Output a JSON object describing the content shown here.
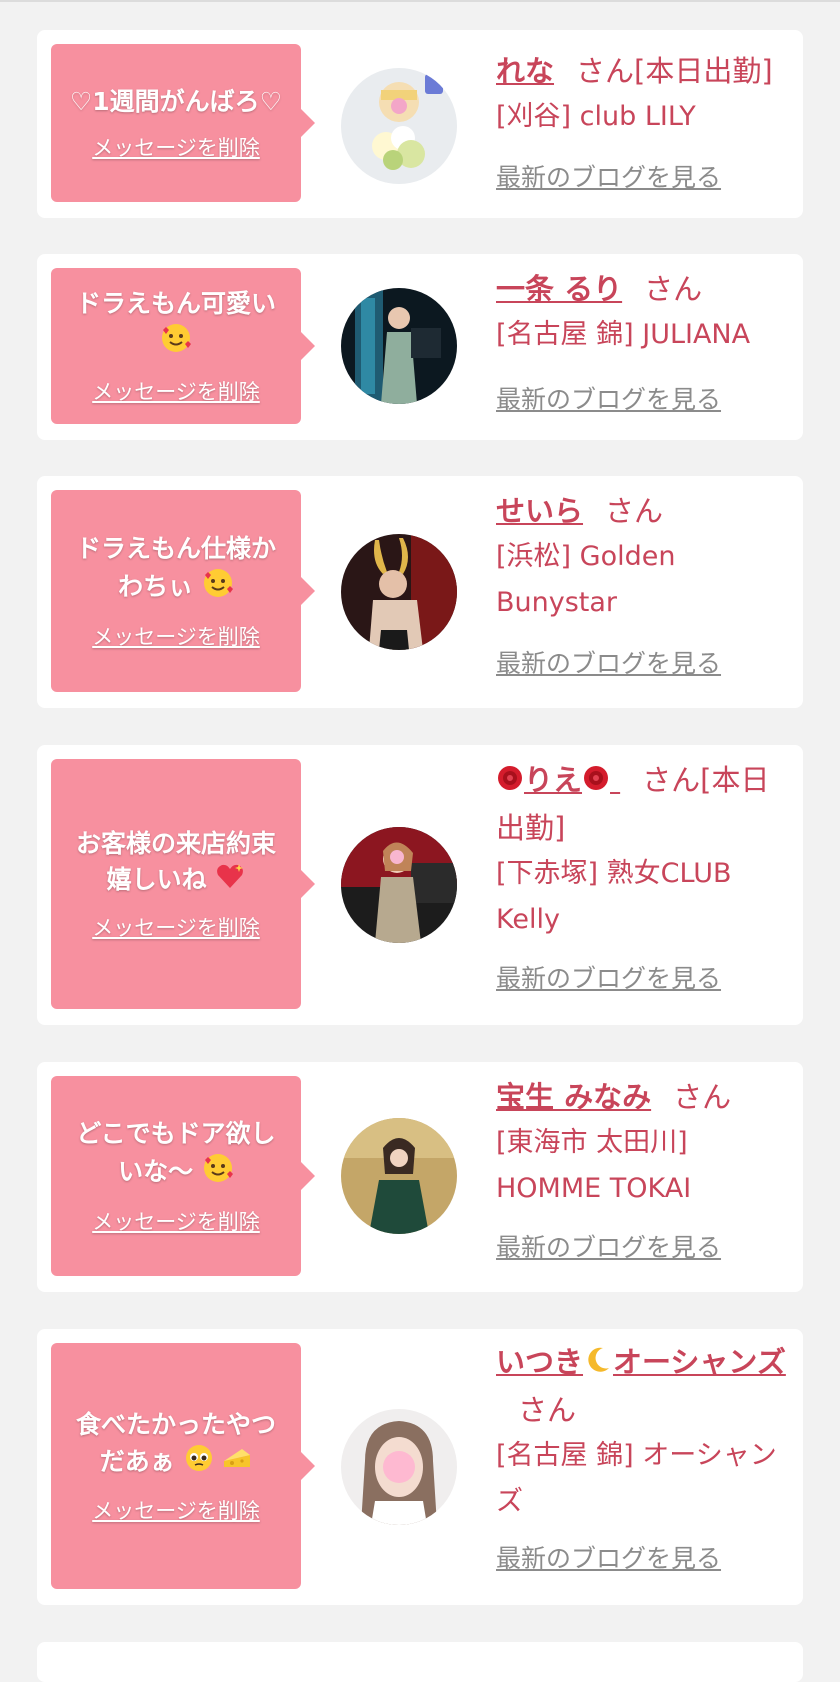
{
  "cards": [
    {
      "message": "♡1週間がんばろ♡",
      "delete_label": "メッセージを削除",
      "name": "れな",
      "san_label": "さん[本日出勤]",
      "shop": "[刈谷] club LILY",
      "blog_label": "最新のブログを見る"
    },
    {
      "message": "ドラえもん可愛い",
      "delete_label": "メッセージを削除",
      "name": "一条 るり",
      "san_label": "さん",
      "shop": "[名古屋 錦] JULIANA",
      "blog_label": "最新のブログを見る"
    },
    {
      "message": "ドラえもん仕様かわちぃ",
      "delete_label": "メッセージを削除",
      "name": "せいら",
      "san_label": "さん",
      "shop": "[浜松] Golden Bunystar",
      "blog_label": "最新のブログを見る"
    },
    {
      "message": "お客様の来店約束嬉しいね",
      "delete_label": "メッセージを削除",
      "name": "りえ",
      "san_label": "さん[本日出勤]",
      "shop": "[下赤塚] 熟女CLUB Kelly",
      "blog_label": "最新のブログを見る"
    },
    {
      "message": "どこでもドア欲しいな〜",
      "delete_label": "メッセージを削除",
      "name": "宝生 みなみ",
      "san_label": "さん",
      "shop": "[東海市 太田川] HOMME TOKAI",
      "blog_label": "最新のブログを見る"
    },
    {
      "message": "食べたかったやつだあぁ",
      "delete_label": "メッセージを削除",
      "name": "いつき",
      "name_suffix": "オーシャンズ",
      "san_label": "さん",
      "shop": "[名古屋 錦] オーシャンズ",
      "blog_label": "最新のブログを見る"
    }
  ],
  "icons": {
    "hug_emoji": "smiling-face-with-hearts-icon",
    "rose_emoji": "rose-icon",
    "heart_emoji": "sparkling-heart-icon",
    "moon_emoji": "crescent-moon-icon",
    "pleading_emoji": "pleading-face-icon",
    "cheese_emoji": "cheese-icon"
  },
  "colors": {
    "bubble": "#f7909f",
    "accent_text": "#c8455a",
    "muted_link": "#8b8b8b",
    "background": "#f2f2f2"
  }
}
